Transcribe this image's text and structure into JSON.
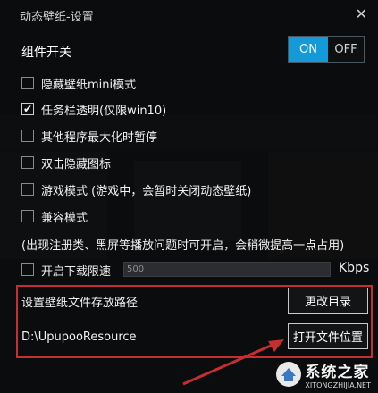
{
  "window": {
    "title": "动态壁纸-设置",
    "close_glyph": "✕"
  },
  "component_switch": {
    "label": "组件开关",
    "on_label": "ON",
    "off_label": "OFF",
    "state": "on",
    "on_color": "#149ad8"
  },
  "options": [
    {
      "label": "隐藏壁纸mini模式",
      "checked": false
    },
    {
      "label": "任务栏透明(仅限win10)",
      "checked": true
    },
    {
      "label": "其他程序最大化时暂停",
      "checked": false
    },
    {
      "label": "双击隐藏图标",
      "checked": false
    },
    {
      "label": "游戏模式 (游戏中，会暂时关闭动态壁纸)",
      "checked": false
    },
    {
      "label": "兼容模式",
      "checked": false
    }
  ],
  "compat_note": "(出现注册类、黑屏等播放问题时可开启，会稍微提高一点占用)",
  "download_limit": {
    "label": "开启下载限速",
    "checked": false,
    "value": "500",
    "unit": "Kbps"
  },
  "storage": {
    "label": "设置壁纸文件存放路径",
    "path": "D:\\UpupooResource",
    "change_button": "更改目录",
    "open_button": "打开文件位置",
    "highlight_color": "#c62f2f"
  },
  "watermark": {
    "name": "系统之家",
    "url": "XITONGZHIJIA.NET"
  }
}
